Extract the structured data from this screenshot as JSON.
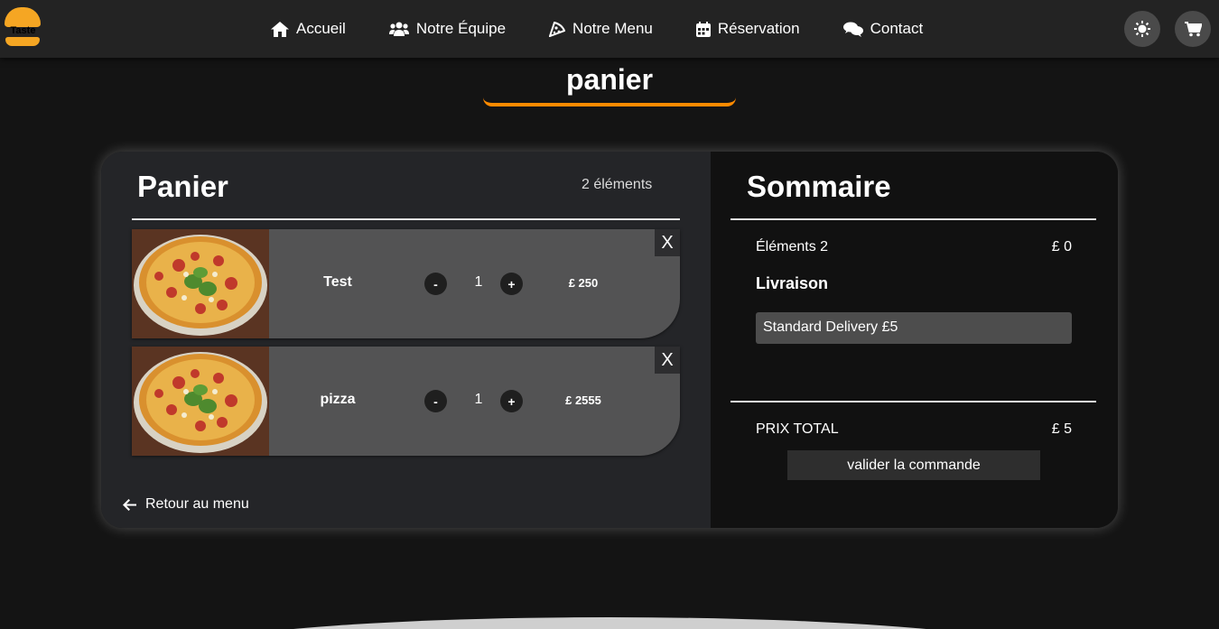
{
  "logo": {
    "text": "Taste"
  },
  "nav": {
    "items": [
      {
        "label": "Accueil",
        "icon": "home-icon"
      },
      {
        "label": "Notre Équipe",
        "icon": "users-icon"
      },
      {
        "label": "Notre Menu",
        "icon": "pizza-slice-icon"
      },
      {
        "label": "Réservation",
        "icon": "calendar-icon"
      },
      {
        "label": "Contact",
        "icon": "comments-icon"
      }
    ],
    "theme_icon": "sun-icon",
    "cart_icon": "cart-icon"
  },
  "page": {
    "title": "panier"
  },
  "cart": {
    "title": "Panier",
    "count": "2 éléments",
    "items": [
      {
        "name": "Test",
        "quantity": "1",
        "price": "£ 250",
        "minus": "-",
        "plus": "+",
        "remove": "X"
      },
      {
        "name": "pizza",
        "quantity": "1",
        "price": "£ 2555",
        "minus": "-",
        "plus": "+",
        "remove": "X"
      }
    ],
    "back_label": "Retour au menu"
  },
  "summary": {
    "title": "Sommaire",
    "items_label": "Éléments 2",
    "items_value": "£ 0",
    "delivery_label": "Livraison",
    "delivery_option": "Standard Delivery £5",
    "total_label": "PRIX TOTAL",
    "total_value": "£ 5",
    "checkout_label": "valider la commande"
  },
  "colors": {
    "accent": "#ff8a00",
    "background": "#141414",
    "navbar": "#232323",
    "cart_panel": "#242528",
    "item_card": "#535354"
  }
}
